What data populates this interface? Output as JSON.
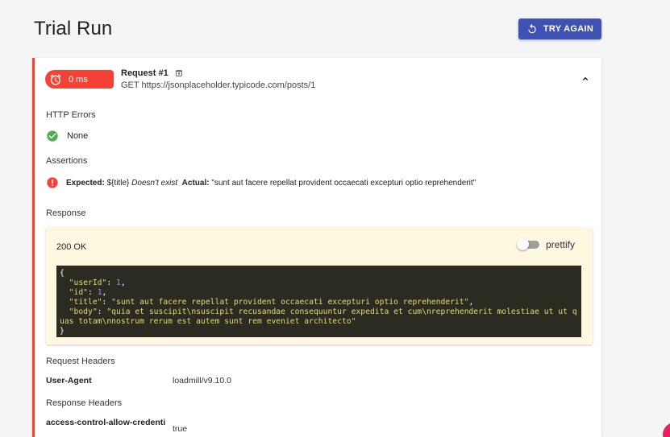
{
  "page": {
    "title": "Trial Run"
  },
  "toolbar": {
    "try_again_label": "TRY AGAIN"
  },
  "request": {
    "duration": "0 ms",
    "title": "Request #1",
    "url": "GET https://jsonplaceholder.typicode.com/posts/1"
  },
  "http_errors": {
    "label": "HTTP Errors",
    "value": "None"
  },
  "assertions": {
    "label": "Assertions",
    "expected_label": "Expected:",
    "expected_value": "${title}",
    "condition": "Doesn't exist",
    "actual_label": "Actual:",
    "actual_value": "\"sunt aut facere repellat provident occaecati excepturi optio reprehenderit\""
  },
  "response": {
    "label": "Response",
    "status": "200 OK",
    "prettify_label": "prettify",
    "prettify_on": false,
    "body": {
      "userId": 1,
      "id": 1,
      "title": "sunt aut facere repellat provident occaecati excepturi optio reprehenderit",
      "body": "quia et suscipit\\nsuscipit recusandae consequuntur expedita et cum\\nreprehenderit molestiae ut ut quas totam\\nnostrum rerum est autem sunt rem eveniet architecto"
    }
  },
  "request_headers": {
    "label": "Request Headers",
    "items": [
      {
        "name": "User-Agent",
        "value": "loadmill/v9.10.0"
      }
    ]
  },
  "response_headers": {
    "label": "Response Headers",
    "items": [
      {
        "name": "access-control-allow-credenti",
        "value": "true"
      }
    ]
  },
  "colors": {
    "primary": "#3f51b5",
    "error": "#f44336",
    "success": "#4caf50",
    "response_bg": "#fff8e1"
  }
}
